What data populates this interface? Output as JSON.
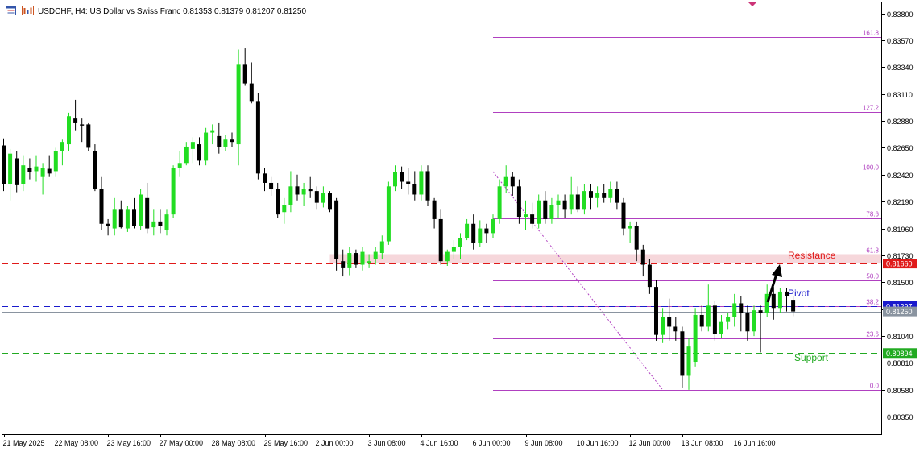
{
  "header": {
    "symbol": "USDCHF",
    "timeframe": "H4",
    "description": "US Dollar vs Swiss Franc",
    "ohlc": "0.81353 0.81379 0.81207 0.81250",
    "icons": [
      "window-icon",
      "chart-grid-icon"
    ]
  },
  "colors": {
    "bull": "#22dd22",
    "bear": "#000000",
    "fib": "#b040c0",
    "resistance": "#e01a1a",
    "pivot": "#1a1acc",
    "support": "#22aa22",
    "zone": "#f3c9cf",
    "bid": "#8a94a0"
  },
  "annotations": {
    "resistance": "Resistance",
    "pivot": "Pivot",
    "support": "Support"
  },
  "chart_data": {
    "type": "candlestick",
    "title": "",
    "ylim": [
      0.802,
      0.839
    ],
    "y_ticks": [
      "0.83800",
      "0.83570",
      "0.83340",
      "0.83110",
      "0.82880",
      "0.82650",
      "0.82420",
      "0.82190",
      "0.81960",
      "0.81730",
      "0.81500",
      "0.81270",
      "0.81040",
      "0.80810",
      "0.80580",
      "0.80350"
    ],
    "x_ticks": [
      "21 May 2025",
      "22 May 08:00",
      "23 May 16:00",
      "27 May 00:00",
      "28 May 08:00",
      "29 May 16:00",
      "2 Jun 00:00",
      "3 Jun 08:00",
      "4 Jun 16:00",
      "6 Jun 00:00",
      "9 Jun 08:00",
      "10 Jun 16:00",
      "12 Jun 00:00",
      "13 Jun 08:00",
      "16 Jun 16:00"
    ],
    "x_tick_index": [
      0,
      8,
      16,
      24,
      32,
      40,
      48,
      56,
      64,
      72,
      80,
      88,
      96,
      104,
      112
    ],
    "candles": [
      [
        0.8267,
        0.8273,
        0.8228,
        0.8234
      ],
      [
        0.8234,
        0.8264,
        0.822,
        0.826
      ],
      [
        0.8256,
        0.8262,
        0.8227,
        0.8233
      ],
      [
        0.8234,
        0.8258,
        0.8228,
        0.825
      ],
      [
        0.8248,
        0.8256,
        0.8238,
        0.8244
      ],
      [
        0.8245,
        0.8258,
        0.8236,
        0.8249
      ],
      [
        0.824,
        0.8252,
        0.8225,
        0.8248
      ],
      [
        0.8247,
        0.8258,
        0.824,
        0.8243
      ],
      [
        0.8245,
        0.8265,
        0.824,
        0.8262
      ],
      [
        0.8262,
        0.8272,
        0.825,
        0.827
      ],
      [
        0.8268,
        0.8295,
        0.8262,
        0.8292
      ],
      [
        0.829,
        0.8306,
        0.828,
        0.8286
      ],
      [
        0.8285,
        0.829,
        0.827,
        0.8284
      ],
      [
        0.8285,
        0.8286,
        0.8262,
        0.8265
      ],
      [
        0.8262,
        0.8268,
        0.8228,
        0.823
      ],
      [
        0.823,
        0.824,
        0.8195,
        0.82
      ],
      [
        0.82,
        0.8204,
        0.819,
        0.8198
      ],
      [
        0.8196,
        0.8222,
        0.819,
        0.8212
      ],
      [
        0.8212,
        0.822,
        0.8196,
        0.8197
      ],
      [
        0.8196,
        0.8215,
        0.8193,
        0.8212
      ],
      [
        0.8212,
        0.8222,
        0.8196,
        0.8198
      ],
      [
        0.8198,
        0.823,
        0.8195,
        0.8225
      ],
      [
        0.8222,
        0.8235,
        0.8192,
        0.8196
      ],
      [
        0.8197,
        0.8212,
        0.819,
        0.8202
      ],
      [
        0.8202,
        0.8212,
        0.8192,
        0.8198
      ],
      [
        0.8195,
        0.8212,
        0.819,
        0.8208
      ],
      [
        0.8208,
        0.825,
        0.8205,
        0.8248
      ],
      [
        0.8248,
        0.8262,
        0.824,
        0.8252
      ],
      [
        0.8252,
        0.827,
        0.825,
        0.8266
      ],
      [
        0.8264,
        0.8274,
        0.8252,
        0.827
      ],
      [
        0.8268,
        0.8274,
        0.825,
        0.8254
      ],
      [
        0.8254,
        0.8282,
        0.825,
        0.8278
      ],
      [
        0.8278,
        0.8285,
        0.8268,
        0.828
      ],
      [
        0.8275,
        0.8286,
        0.826,
        0.8266
      ],
      [
        0.8266,
        0.8276,
        0.8262,
        0.8272
      ],
      [
        0.8272,
        0.8278,
        0.8266,
        0.827
      ],
      [
        0.8268,
        0.8349,
        0.825,
        0.8336
      ],
      [
        0.8336,
        0.835,
        0.8318,
        0.832
      ],
      [
        0.832,
        0.8338,
        0.8303,
        0.8305
      ],
      [
        0.8305,
        0.8312,
        0.8238,
        0.8243
      ],
      [
        0.8243,
        0.8248,
        0.8228,
        0.8235
      ],
      [
        0.8235,
        0.824,
        0.8224,
        0.823
      ],
      [
        0.823,
        0.8235,
        0.8205,
        0.8208
      ],
      [
        0.821,
        0.8222,
        0.82,
        0.8216
      ],
      [
        0.8216,
        0.8245,
        0.821,
        0.8232
      ],
      [
        0.8232,
        0.8242,
        0.822,
        0.8225
      ],
      [
        0.8225,
        0.8235,
        0.8215,
        0.823
      ],
      [
        0.823,
        0.824,
        0.8222,
        0.8228
      ],
      [
        0.8228,
        0.8232,
        0.8212,
        0.8218
      ],
      [
        0.8218,
        0.8232,
        0.8214,
        0.8226
      ],
      [
        0.8226,
        0.8228,
        0.821,
        0.8212
      ],
      [
        0.822,
        0.8222,
        0.816,
        0.817
      ],
      [
        0.8168,
        0.8178,
        0.8155,
        0.8162
      ],
      [
        0.8162,
        0.818,
        0.8156,
        0.8175
      ],
      [
        0.8175,
        0.8178,
        0.8162,
        0.8165
      ],
      [
        0.8165,
        0.818,
        0.816,
        0.8176
      ],
      [
        0.8166,
        0.8174,
        0.8162,
        0.8168
      ],
      [
        0.817,
        0.818,
        0.8165,
        0.8176
      ],
      [
        0.8175,
        0.819,
        0.817,
        0.8185
      ],
      [
        0.8185,
        0.8236,
        0.8182,
        0.8232
      ],
      [
        0.8232,
        0.825,
        0.8228,
        0.8244
      ],
      [
        0.8244,
        0.8249,
        0.823,
        0.8236
      ],
      [
        0.8236,
        0.8248,
        0.8225,
        0.8234
      ],
      [
        0.8234,
        0.8245,
        0.822,
        0.8225
      ],
      [
        0.8225,
        0.825,
        0.822,
        0.8245
      ],
      [
        0.8245,
        0.825,
        0.8215,
        0.822
      ],
      [
        0.822,
        0.8222,
        0.8196,
        0.8204
      ],
      [
        0.8204,
        0.8212,
        0.8165,
        0.8168
      ],
      [
        0.8168,
        0.8178,
        0.8164,
        0.8176
      ],
      [
        0.8176,
        0.8186,
        0.817,
        0.818
      ],
      [
        0.818,
        0.8192,
        0.817,
        0.8188
      ],
      [
        0.8188,
        0.8204,
        0.8186,
        0.82
      ],
      [
        0.82,
        0.8208,
        0.8178,
        0.8184
      ],
      [
        0.8184,
        0.8203,
        0.818,
        0.8196
      ],
      [
        0.8196,
        0.82,
        0.8184,
        0.8192
      ],
      [
        0.8192,
        0.8208,
        0.8188,
        0.8204
      ],
      [
        0.8204,
        0.8238,
        0.82,
        0.8232
      ],
      [
        0.8232,
        0.825,
        0.8226,
        0.824
      ],
      [
        0.824,
        0.8244,
        0.8224,
        0.8232
      ],
      [
        0.8232,
        0.8238,
        0.82,
        0.8206
      ],
      [
        0.8206,
        0.822,
        0.8195,
        0.8208
      ],
      [
        0.8208,
        0.8218,
        0.8196,
        0.82
      ],
      [
        0.82,
        0.8225,
        0.8196,
        0.822
      ],
      [
        0.822,
        0.8228,
        0.82,
        0.8204
      ],
      [
        0.8204,
        0.8222,
        0.82,
        0.8216
      ],
      [
        0.8216,
        0.8225,
        0.8205,
        0.822
      ],
      [
        0.822,
        0.8225,
        0.8205,
        0.8212
      ],
      [
        0.8212,
        0.824,
        0.8208,
        0.8225
      ],
      [
        0.8225,
        0.8232,
        0.821,
        0.8212
      ],
      [
        0.8212,
        0.8234,
        0.8208,
        0.8228
      ],
      [
        0.8228,
        0.8234,
        0.8212,
        0.8222
      ],
      [
        0.8222,
        0.8232,
        0.8214,
        0.8226
      ],
      [
        0.8226,
        0.8234,
        0.8218,
        0.8222
      ],
      [
        0.8222,
        0.8236,
        0.8218,
        0.823
      ],
      [
        0.823,
        0.8236,
        0.8212,
        0.8218
      ],
      [
        0.8218,
        0.8222,
        0.819,
        0.8196
      ],
      [
        0.8196,
        0.8202,
        0.8184,
        0.8198
      ],
      [
        0.8198,
        0.8202,
        0.8168,
        0.8178
      ],
      [
        0.8178,
        0.8182,
        0.8155,
        0.8165
      ],
      [
        0.8165,
        0.817,
        0.814,
        0.8146
      ],
      [
        0.8146,
        0.8152,
        0.81,
        0.8105
      ],
      [
        0.8105,
        0.8128,
        0.8098,
        0.812
      ],
      [
        0.812,
        0.8136,
        0.81,
        0.8112
      ],
      [
        0.8112,
        0.812,
        0.81,
        0.8108
      ],
      [
        0.8108,
        0.8112,
        0.806,
        0.807
      ],
      [
        0.807,
        0.8102,
        0.8058,
        0.8095
      ],
      [
        0.8082,
        0.8128,
        0.8078,
        0.8122
      ],
      [
        0.8122,
        0.813,
        0.8108,
        0.8112
      ],
      [
        0.8112,
        0.8148,
        0.8108,
        0.813
      ],
      [
        0.813,
        0.8134,
        0.81,
        0.8106
      ],
      [
        0.8106,
        0.8122,
        0.8102,
        0.8116
      ],
      [
        0.8116,
        0.8124,
        0.811,
        0.812
      ],
      [
        0.812,
        0.814,
        0.8112,
        0.8132
      ],
      [
        0.8132,
        0.8138,
        0.8108,
        0.8124
      ],
      [
        0.8124,
        0.813,
        0.81,
        0.8108
      ],
      [
        0.8108,
        0.813,
        0.8104,
        0.8126
      ],
      [
        0.8126,
        0.813,
        0.809,
        0.8124
      ],
      [
        0.8124,
        0.8148,
        0.812,
        0.814
      ],
      [
        0.814,
        0.8146,
        0.8118,
        0.8128
      ],
      [
        0.8128,
        0.8145,
        0.8124,
        0.8142
      ],
      [
        0.8142,
        0.8145,
        0.8125,
        0.8138
      ],
      [
        0.8135,
        0.8138,
        0.8121,
        0.8125
      ]
    ],
    "fibonacci": {
      "swing_high": 0.82446,
      "swing_low": 0.8058,
      "start_index": 75,
      "levels": [
        {
          "label": "161.8",
          "ratio": 1.618
        },
        {
          "label": "127.2",
          "ratio": 1.272
        },
        {
          "label": "100.0",
          "ratio": 1.0
        },
        {
          "label": "78.6",
          "ratio": 0.786
        },
        {
          "label": "61.8",
          "ratio": 0.618
        },
        {
          "label": "50.0",
          "ratio": 0.5
        },
        {
          "label": "38.2",
          "ratio": 0.382
        },
        {
          "label": "23.6",
          "ratio": 0.236
        },
        {
          "label": "0.0",
          "ratio": 0.0
        }
      ]
    },
    "resistance_zone": {
      "low": 0.8166,
      "high": 0.8174,
      "start_index": 50
    },
    "price_lines": [
      {
        "name": "resistance",
        "value": 0.8166,
        "label": "0.81660"
      },
      {
        "name": "pivot",
        "value": 0.81297,
        "label": "0.81297"
      },
      {
        "name": "support",
        "value": 0.80894,
        "label": "0.80894"
      },
      {
        "name": "bid",
        "value": 0.8125,
        "label": "0.81250"
      }
    ]
  }
}
